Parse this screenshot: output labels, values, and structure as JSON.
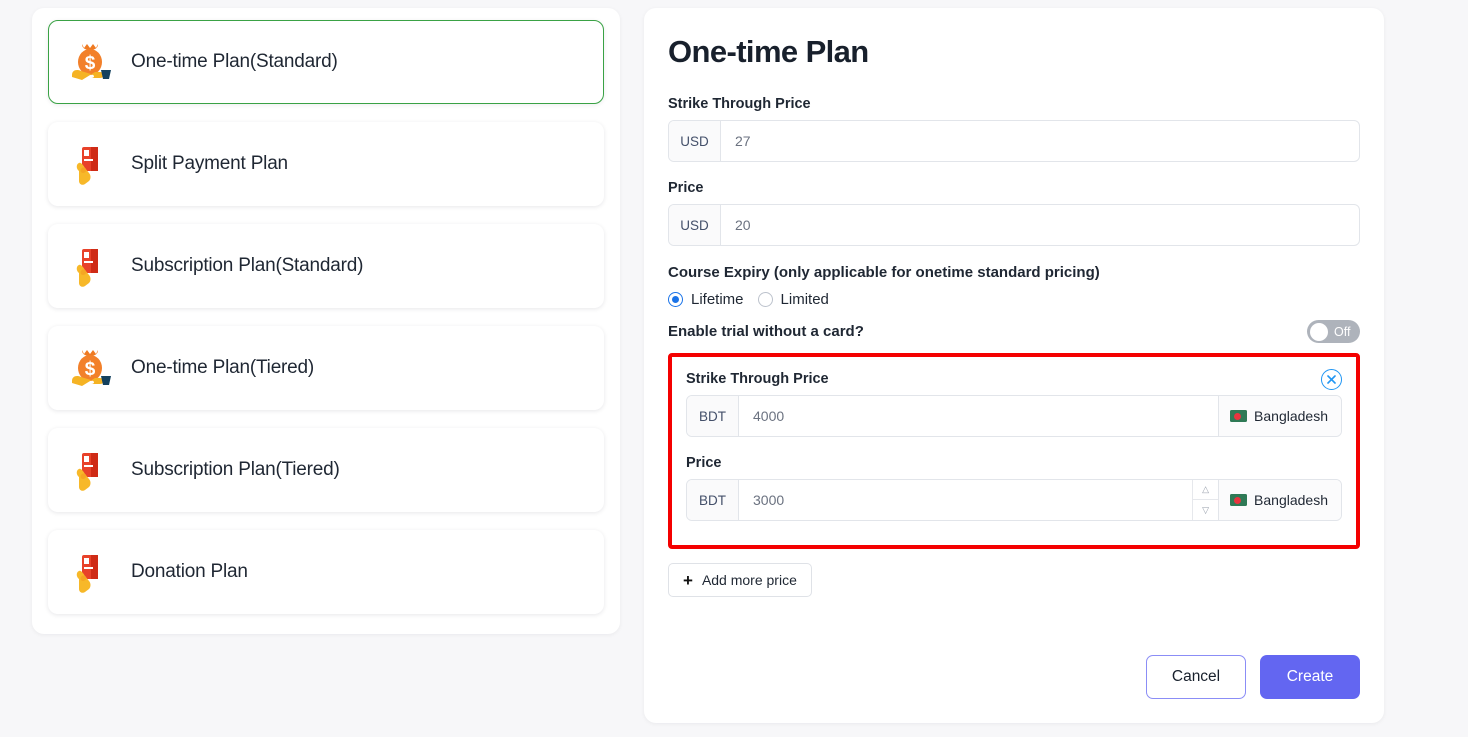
{
  "sidebar": {
    "items": [
      {
        "label": "One-time Plan(Standard)",
        "icon": "money-bag-icon",
        "selected": true
      },
      {
        "label": "Split Payment Plan",
        "icon": "hand-card-icon",
        "selected": false
      },
      {
        "label": "Subscription Plan(Standard)",
        "icon": "hand-card-icon",
        "selected": false
      },
      {
        "label": "One-time Plan(Tiered)",
        "icon": "money-bag-icon",
        "selected": false
      },
      {
        "label": "Subscription Plan(Tiered)",
        "icon": "hand-card-icon",
        "selected": false
      },
      {
        "label": "Donation Plan",
        "icon": "hand-card-icon",
        "selected": false
      }
    ]
  },
  "panel": {
    "title": "One-time Plan",
    "usd_strike": {
      "label": "Strike Through Price",
      "currency": "USD",
      "value": "27"
    },
    "usd_price": {
      "label": "Price",
      "currency": "USD",
      "value": "20"
    },
    "course_expiry": {
      "label": "Course Expiry (only applicable for onetime standard pricing)",
      "options": [
        {
          "label": "Lifetime",
          "selected": true
        },
        {
          "label": "Limited",
          "selected": false
        }
      ]
    },
    "trial": {
      "label": "Enable trial without a card?",
      "state": "Off"
    },
    "extra_price_block": {
      "strike": {
        "label": "Strike Through Price",
        "currency": "BDT",
        "value": "4000",
        "country": "Bangladesh"
      },
      "price": {
        "label": "Price",
        "currency": "BDT",
        "value": "3000",
        "country": "Bangladesh"
      },
      "close_icon": "close-circle-icon"
    },
    "add_more_label": "Add more price",
    "cancel_label": "Cancel",
    "create_label": "Create"
  },
  "colors": {
    "selected_border": "#3aa245",
    "highlight_border": "#f40000",
    "primary": "#6366f1",
    "radio_blue": "#1a73e8",
    "close_blue": "#2196f3",
    "flag_green": "#2f7a56",
    "flag_red": "#e8343f"
  }
}
